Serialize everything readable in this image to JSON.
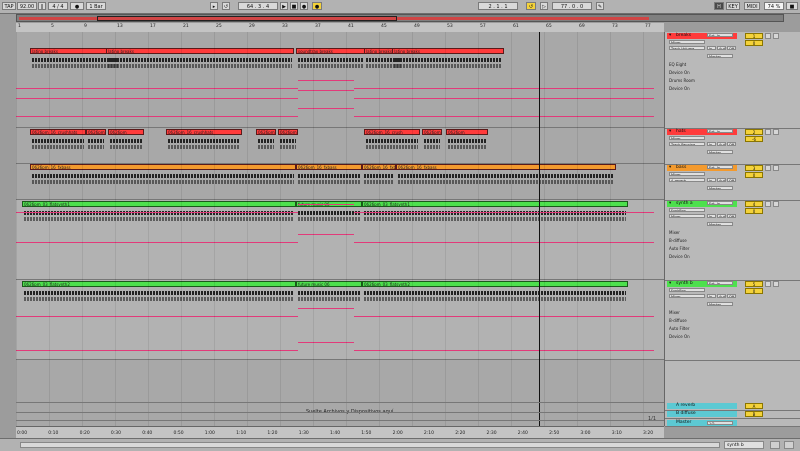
{
  "transport": {
    "tap": "TAP",
    "tempo": "92.00",
    "signature": "4 / 4",
    "quantize": "1 Bar",
    "position": "64 . 3 . 4",
    "loop_start": "2 . 1 . 1",
    "loop_length": "77 . 0 . 0",
    "key": "KEY",
    "midi": "MIDI",
    "cpu": "74 %",
    "mode": "H"
  },
  "ruler": {
    "bars": [
      "1",
      "5",
      "9",
      "13",
      "17",
      "21",
      "25",
      "29",
      "33",
      "37",
      "41",
      "45",
      "49",
      "53",
      "57",
      "61",
      "65",
      "69",
      "73",
      "77"
    ]
  },
  "timeline": {
    "times": [
      "0:00",
      "0:10",
      "0:20",
      "0:30",
      "0:40",
      "0:50",
      "1:00",
      "1:10",
      "1:20",
      "1:30",
      "1:40",
      "1:50",
      "2:00",
      "2:10",
      "2:20",
      "2:30",
      "2:40",
      "2:50",
      "3:00",
      "3:10",
      "3:20"
    ]
  },
  "arrangement": {
    "drop_text": "Suelte Archivos y Dispositivos aquí",
    "page_indicator": "1/1",
    "lanes": [
      {
        "name": "breaks",
        "color": "#ff3b3b",
        "clips": [
          {
            "label": "latino breaks"
          },
          {
            "label": "latino breaks"
          },
          {
            "label": "soundtrax breaks"
          },
          {
            "label": "latino breaks"
          },
          {
            "label": "latino breaks"
          }
        ]
      },
      {
        "name": "hats",
        "color": "#ff3b3b",
        "clips": [
          {
            "label": "0626pm_16_crushhats"
          },
          {
            "label": "0626pm"
          },
          {
            "label": "0626pm"
          },
          {
            "label": "0626pm_16_crushhats"
          },
          {
            "label": "0626pm"
          },
          {
            "label": "0626pm"
          },
          {
            "label": "0626pm_16_crush"
          },
          {
            "label": "0626pm"
          },
          {
            "label": "0626pm"
          }
        ]
      },
      {
        "name": "bass",
        "color": "#f39a2e",
        "clips": [
          {
            "label": "0626pm_16_fxbass"
          },
          {
            "label": "0626pm_16_fxbass"
          },
          {
            "label": "0626pm_16_fxb"
          },
          {
            "label": "0626pm_16_fxbass"
          }
        ]
      },
      {
        "name": "synth a",
        "color": "#4de04d",
        "clips": [
          {
            "label": "0626pm_03_flatsynth1"
          },
          {
            "label": "future music 06"
          },
          {
            "label": "0626pm_03_flatsynth1"
          }
        ]
      },
      {
        "name": "synth b",
        "color": "#4de04d",
        "clips": [
          {
            "label": "0626pm_03_flatsynth2"
          },
          {
            "label": "future music 06"
          },
          {
            "label": "0626pm_03_flatsynth2"
          }
        ]
      }
    ]
  },
  "mixer": {
    "tracks": [
      {
        "name": "breaks",
        "color": "#ff3b3b",
        "input": "Ext. In",
        "device_chain": [
          "Mixer",
          "Track Volume"
        ],
        "devices": [
          "EQ Eight",
          "Device On",
          "Drums Room",
          "Device On"
        ],
        "number": "1",
        "monitor": [
          "In",
          "Auto",
          "Off"
        ],
        "output": "Master",
        "vol": "0"
      },
      {
        "name": "hats",
        "color": "#ff3b3b",
        "input": "Ext. In",
        "device_chain": [
          "Mixer",
          "Track Panning"
        ],
        "devices": [],
        "number": "2",
        "monitor": [
          "In",
          "Auto",
          "Off"
        ],
        "output": "Master",
        "vol": "-6"
      },
      {
        "name": "bass",
        "color": "#f39a2e",
        "input": "Ext. In",
        "device_chain": [
          "Mixer",
          "A-reverb"
        ],
        "devices": [],
        "number": "3",
        "monitor": [
          "In",
          "Auto",
          "Off"
        ],
        "output": "Master",
        "vol": "0"
      },
      {
        "name": "synth a",
        "color": "#4de04d",
        "input": "Ext. In",
        "device_chain": [
          "FunkBox",
          "Mixer"
        ],
        "devices": [
          "Mixer",
          "B-diffuse",
          "Auto Filter",
          "Device On"
        ],
        "number": "4",
        "monitor": [
          "In",
          "Auto",
          "Off"
        ],
        "output": "Master",
        "vol": "0"
      },
      {
        "name": "synth b",
        "color": "#4de04d",
        "input": "Ext. In",
        "device_chain": [
          "FunkBox",
          "Mixer"
        ],
        "devices": [
          "Mixer",
          "B-diffuse",
          "Auto Filter",
          "Device On"
        ],
        "number": "5",
        "monitor": [
          "In",
          "Auto",
          "Off"
        ],
        "output": "Master",
        "vol": "0"
      }
    ],
    "returns": [
      {
        "name": "A reverb",
        "letter": "A"
      },
      {
        "name": "B diffuse",
        "letter": "B"
      }
    ],
    "master": {
      "name": "Master",
      "output": "1/2"
    }
  },
  "status": {
    "track_label": "synth b"
  },
  "colors": {
    "automation": "#e23a7a",
    "accent": "#f4d23a",
    "return_color": "#5cc9d3"
  }
}
